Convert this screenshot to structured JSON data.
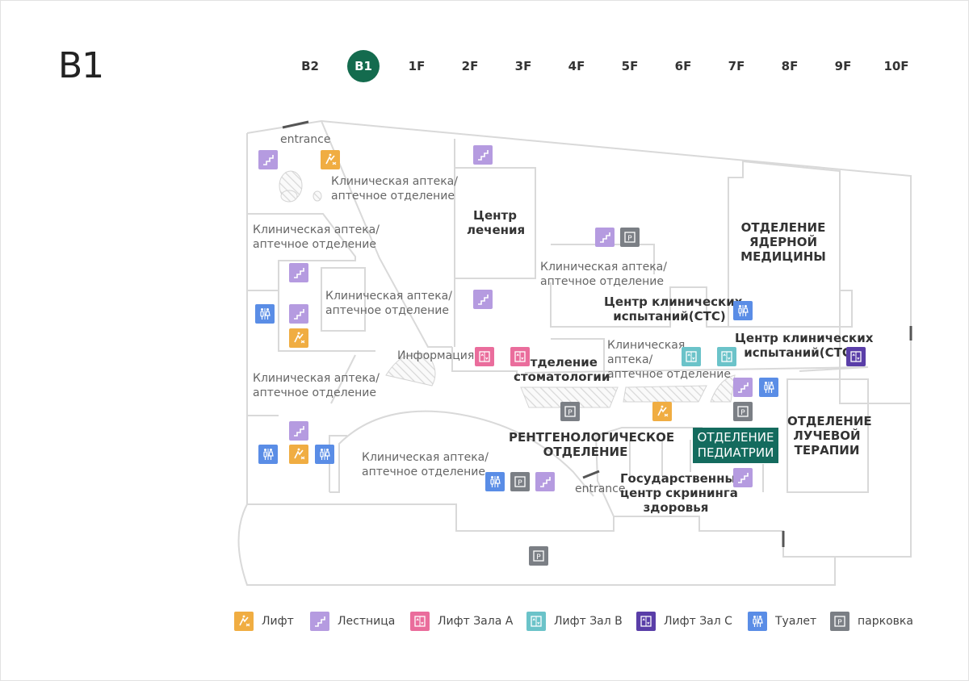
{
  "floor_title": "B1",
  "floors": [
    "B2",
    "B1",
    "1F",
    "2F",
    "3F",
    "4F",
    "5F",
    "6F",
    "7F",
    "8F",
    "9F",
    "10F"
  ],
  "active_floor": "B1",
  "colors": {
    "elevator": "#f0ad42",
    "stairs": "#b59be0",
    "lift_a": "#ea6d9c",
    "lift_b": "#6bc3c9",
    "lift_c": "#5a3ea8",
    "toilet": "#5a8de6",
    "parking": "#7b7f85",
    "active": "#146b4e",
    "highlight": "#146b5e"
  },
  "labels": {
    "entrance_top": "entrance",
    "entrance_bottom": "entrance",
    "pharmacy_1": "Клиническая аптека/\nаптечное отделение",
    "pharmacy_2": "Клиническая аптека/\nаптечное отделение",
    "pharmacy_3": "Клиническая аптека/\nаптечное отделение",
    "pharmacy_4": "Клиническая аптека/\nаптечное отделение",
    "pharmacy_5": "Клиническая аптека/\nаптечное отделение",
    "pharmacy_6": "Клиническая аптека/\nаптечное отделение",
    "pharmacy_7": "Клиническая\nаптека/\nаптечное отделение",
    "treatment_center": "Центр\nлечения",
    "nuclear_medicine": "ОТДЕЛЕНИЕ\nЯДЕРНОЙ\nМЕДИЦИНЫ",
    "ctc_1": "Центр клинических\nиспытаний(CTC)",
    "ctc_2": "Центр клинических\nиспытаний(CTC)",
    "information": "Информация",
    "dentistry": "Отделение\nстоматологии",
    "radiology": "РЕНТГЕНОЛОГИЧЕСКОЕ\nОТДЕЛЕНИЕ",
    "pediatrics": "ОТДЕЛЕНИЕ\nПЕДИАТРИИ",
    "radiation_therapy": "ОТДЕЛЕНИЕ\nЛУЧЕВОЙ\nТЕРАПИИ",
    "screening": "Государственный\nцентр скрининга\nздоровья"
  },
  "legend": [
    {
      "type": "elevator",
      "label": "Лифт"
    },
    {
      "type": "stairs",
      "label": "Лестница"
    },
    {
      "type": "lift_a",
      "label": "Лифт Зала A"
    },
    {
      "type": "lift_b",
      "label": "Лифт Зал B"
    },
    {
      "type": "lift_c",
      "label": "Лифт Зал C"
    },
    {
      "type": "toilet",
      "label": "Туалет"
    },
    {
      "type": "parking",
      "label": "парковка"
    }
  ]
}
